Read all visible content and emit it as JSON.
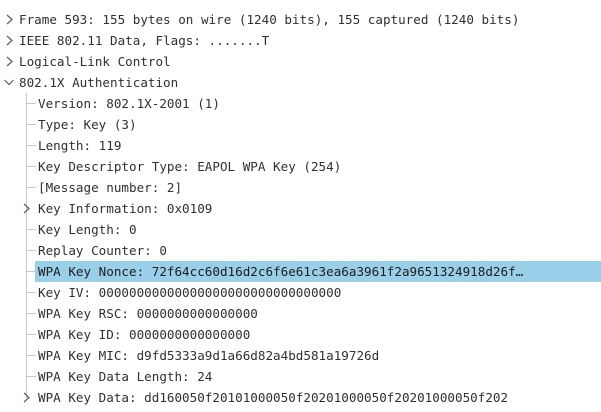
{
  "packet_details": {
    "top_level": [
      {
        "label": "Frame 593: 155 bytes on wire (1240 bits), 155 captured (1240 bits)",
        "expanded": false
      },
      {
        "label": "IEEE 802.11 Data, Flags: .......T",
        "expanded": false
      },
      {
        "label": "Logical-Link Control",
        "expanded": false
      },
      {
        "label": "802.1X Authentication",
        "expanded": true
      }
    ],
    "children": [
      {
        "label": "Version: 802.1X-2001 (1)"
      },
      {
        "label": "Type: Key (3)"
      },
      {
        "label": "Length: 119"
      },
      {
        "label": "Key Descriptor Type: EAPOL WPA Key (254)"
      },
      {
        "label": "[Message number: 2]"
      },
      {
        "label": "Key Information: 0x0109",
        "expandable": true,
        "expanded": false
      },
      {
        "label": "Key Length: 0"
      },
      {
        "label": "Replay Counter: 0"
      },
      {
        "label": "WPA Key Nonce: 72f64cc60d16d2c6f6e61c3ea6a3961f2a9651324918d26f…",
        "selected": true
      },
      {
        "label": "Key IV: 00000000000000000000000000000000"
      },
      {
        "label": "WPA Key RSC: 0000000000000000"
      },
      {
        "label": "WPA Key ID: 0000000000000000"
      },
      {
        "label": "WPA Key MIC: d9fd5333a9d1a66d82a4bd581a19726d"
      },
      {
        "label": "WPA Key Data Length: 24"
      },
      {
        "label": "WPA Key Data: dd160050f20101000050f20201000050f20201000050f202",
        "expandable": true,
        "expanded": false
      }
    ]
  },
  "colors": {
    "selection": "#99cfe8",
    "text": "#303030",
    "tree_lines": "#c8c8c8"
  },
  "icons": {
    "collapsed": "chevron-right-icon",
    "expanded": "chevron-down-icon"
  }
}
